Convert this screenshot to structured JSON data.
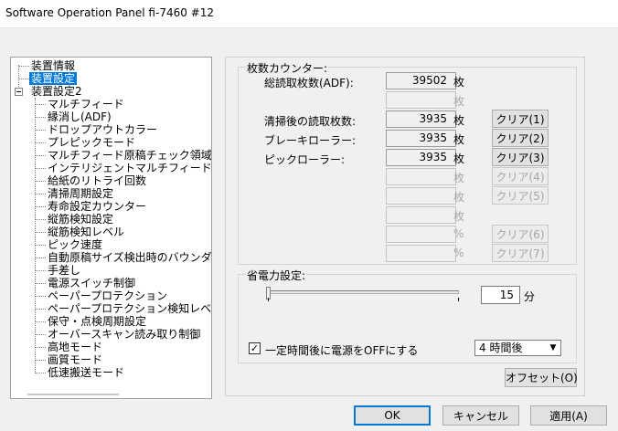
{
  "window": {
    "title": "Software Operation Panel fi-7460 #12"
  },
  "tree": {
    "root_items": [
      "装置情報",
      "装置設定",
      "装置設定2"
    ],
    "children": [
      "マルチフィード",
      "縁消し(ADF)",
      "ドロップアウトカラー",
      "プレピックモード",
      "マルチフィード原稿チェック領域指定",
      "インテリジェントマルチフィード設定",
      "給紙のリトライ回数",
      "清掃周期設定",
      "寿命設定カウンター",
      "縦筋検知設定",
      "縦筋検知レベル",
      "ピック速度",
      "自動原稿サイズ検出時のバウンダリー",
      "手差し",
      "電源スイッチ制御",
      "ペーパープロテクション",
      "ペーパープロテクション検知レベル",
      "保守・点検周期設定",
      "オーバースキャン読み取り制御",
      "高地モード",
      "画質モード",
      "低速搬送モード"
    ]
  },
  "counters": {
    "legend": "枚数カウンター:",
    "total_label": "総読取枚数(ADF):",
    "total_value": "39502",
    "total_unit": "枚",
    "blank1_unit": "枚",
    "after_clean_label": "清掃後の読取枚数:",
    "after_clean_value": "3935",
    "after_clean_unit": "枚",
    "brake_label": "ブレーキローラー:",
    "brake_value": "3935",
    "brake_unit": "枚",
    "pick_label": "ピックローラー:",
    "pick_value": "3935",
    "pick_unit": "枚",
    "blank2_unit": "枚",
    "blank3_unit": "枚",
    "blank4_unit": "枚",
    "blank5_unit": "%",
    "blank6_unit": "%",
    "clear1": "クリア(1)",
    "clear2": "クリア(2)",
    "clear3": "クリア(3)",
    "clear4": "クリア(4)",
    "clear5": "クリア(5)",
    "clear6": "クリア(6)",
    "clear7": "クリア(7)"
  },
  "power": {
    "legend": "省電力設定:",
    "minutes": "15",
    "minutes_unit": "分",
    "checkbox_checked": true,
    "checkbox_label": "一定時間後に電源をOFFにする",
    "select_value": "4 時間後"
  },
  "buttons": {
    "offset": "オフセット(O)",
    "ok": "OK",
    "cancel": "キャンセル",
    "apply": "適用(A)"
  }
}
